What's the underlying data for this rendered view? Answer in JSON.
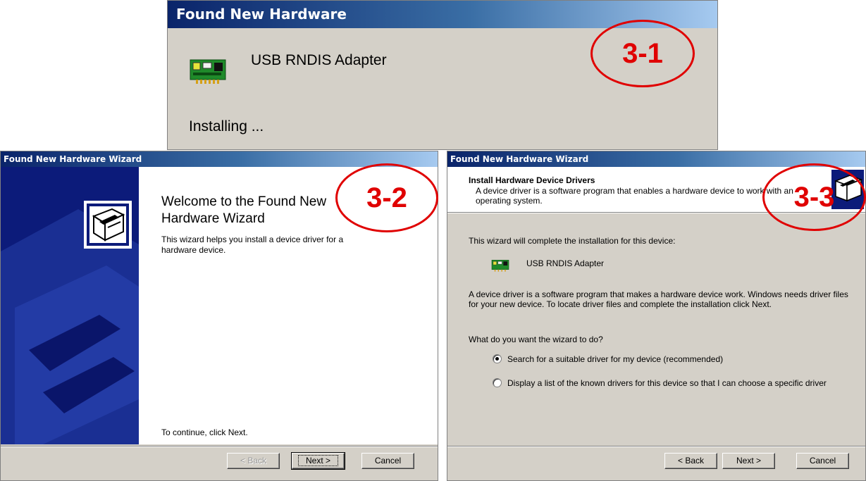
{
  "popup": {
    "title": "Found New Hardware",
    "device_name": "USB RNDIS Adapter",
    "status": "Installing ..."
  },
  "welcome_wizard": {
    "title": "Found New Hardware Wizard",
    "heading": "Welcome to the Found New Hardware Wizard",
    "description": "This wizard helps you install a device driver for a hardware device.",
    "continue_text": "To continue, click Next.",
    "buttons": {
      "back": "< Back",
      "next": "Next >",
      "cancel": "Cancel"
    }
  },
  "install_wizard": {
    "title": "Found New Hardware Wizard",
    "header_title": "Install Hardware Device Drivers",
    "header_desc": "A device driver is a software program that enables a hardware device to work with an operating system.",
    "intro": "This wizard will complete the installation for this device:",
    "device_name": "USB RNDIS Adapter",
    "explanation": "A device driver is a software program that makes a hardware device work. Windows needs driver files for your new device. To locate driver files and complete the installation click Next.",
    "question": "What do you want the wizard to do?",
    "options": [
      {
        "label": "Search for a suitable driver for my device (recommended)",
        "checked": true
      },
      {
        "label": "Display a list of the known drivers for this device so that I can choose a specific driver",
        "checked": false
      }
    ],
    "buttons": {
      "back": "< Back",
      "next": "Next >",
      "cancel": "Cancel"
    }
  },
  "annotations": {
    "step1": "3-1",
    "step2": "3-2",
    "step3": "3-3"
  },
  "colors": {
    "title_dark": "#0a246a",
    "title_light": "#a6caf0",
    "dialog_bg": "#d4d0c8",
    "annotation": "#e00000"
  },
  "icons": [
    "hardware-card-icon",
    "hardware-install-icon"
  ]
}
